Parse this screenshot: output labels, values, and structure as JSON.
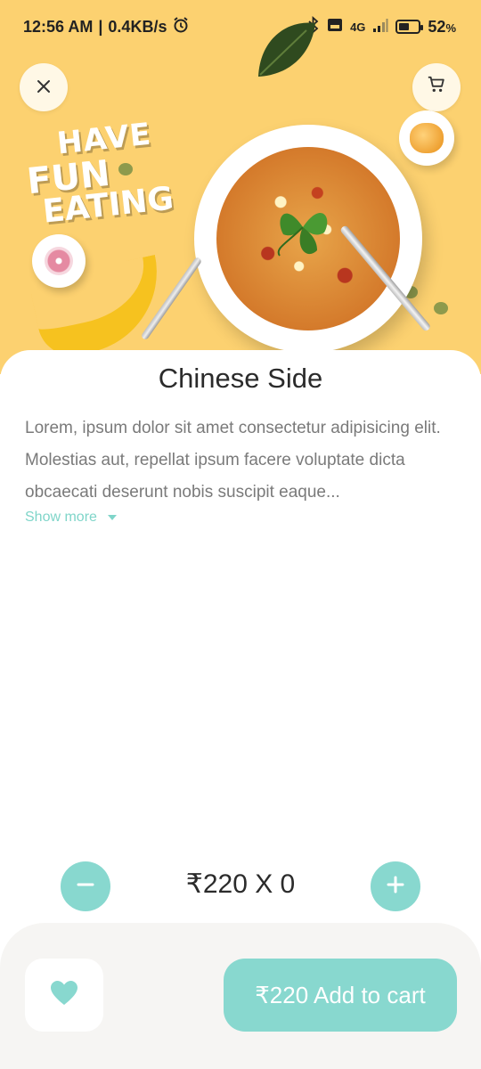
{
  "status_bar": {
    "time": "12:56 AM",
    "separator": "|",
    "speed": "0.4KB/s",
    "alarm_icon": "alarm-icon",
    "network_label": "4G",
    "battery_percent": "52",
    "battery_unit": "%"
  },
  "header": {
    "close_icon": "close-icon",
    "cart_icon": "cart-icon"
  },
  "hero": {
    "slogan_line1": "HAVE",
    "slogan_line2": "FUN",
    "slogan_line3": "EATING"
  },
  "product": {
    "title": "Chinese Side",
    "description": "Lorem, ipsum dolor sit amet consectetur adipisicing elit. Molestias aut, repellat ipsum facere voluptate dicta obcaecati deserunt nobis suscipit eaque...",
    "show_more_label": "Show more"
  },
  "quantity": {
    "display": "₹220 X 0"
  },
  "actions": {
    "add_to_cart_label": "₹220 Add to cart"
  },
  "colors": {
    "hero_background": "#fcd170",
    "accent": "#88d8cf",
    "accent_text": "#7fd5c9",
    "bottom_bar": "#f6f5f3"
  }
}
